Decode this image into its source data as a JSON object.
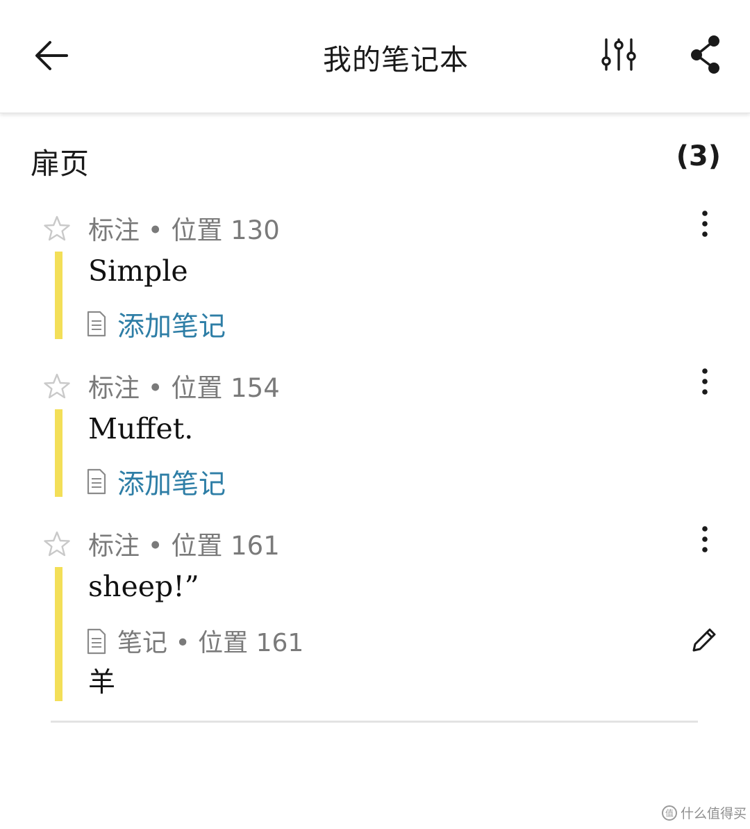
{
  "header": {
    "title": "我的笔记本",
    "back_icon": "arrow-left-icon",
    "filter_icon": "sliders-icon",
    "share_icon": "share-icon"
  },
  "section": {
    "title": "扉页",
    "count": "(3)"
  },
  "entries": [
    {
      "meta": "标注 • 位置 130",
      "quote": "Simple",
      "add_note": "添加笔记"
    },
    {
      "meta": "标注 • 位置 154",
      "quote": "Muffet.",
      "add_note": "添加笔记"
    },
    {
      "meta": "标注 • 位置 161",
      "quote": "sheep!”",
      "note_meta": "笔记 • 位置 161",
      "note_text": "羊"
    }
  ],
  "colors": {
    "highlight_bar": "#f3df58",
    "link": "#2e7ea6",
    "meta_text": "#7a7a7a"
  },
  "watermark": "什么值得买"
}
